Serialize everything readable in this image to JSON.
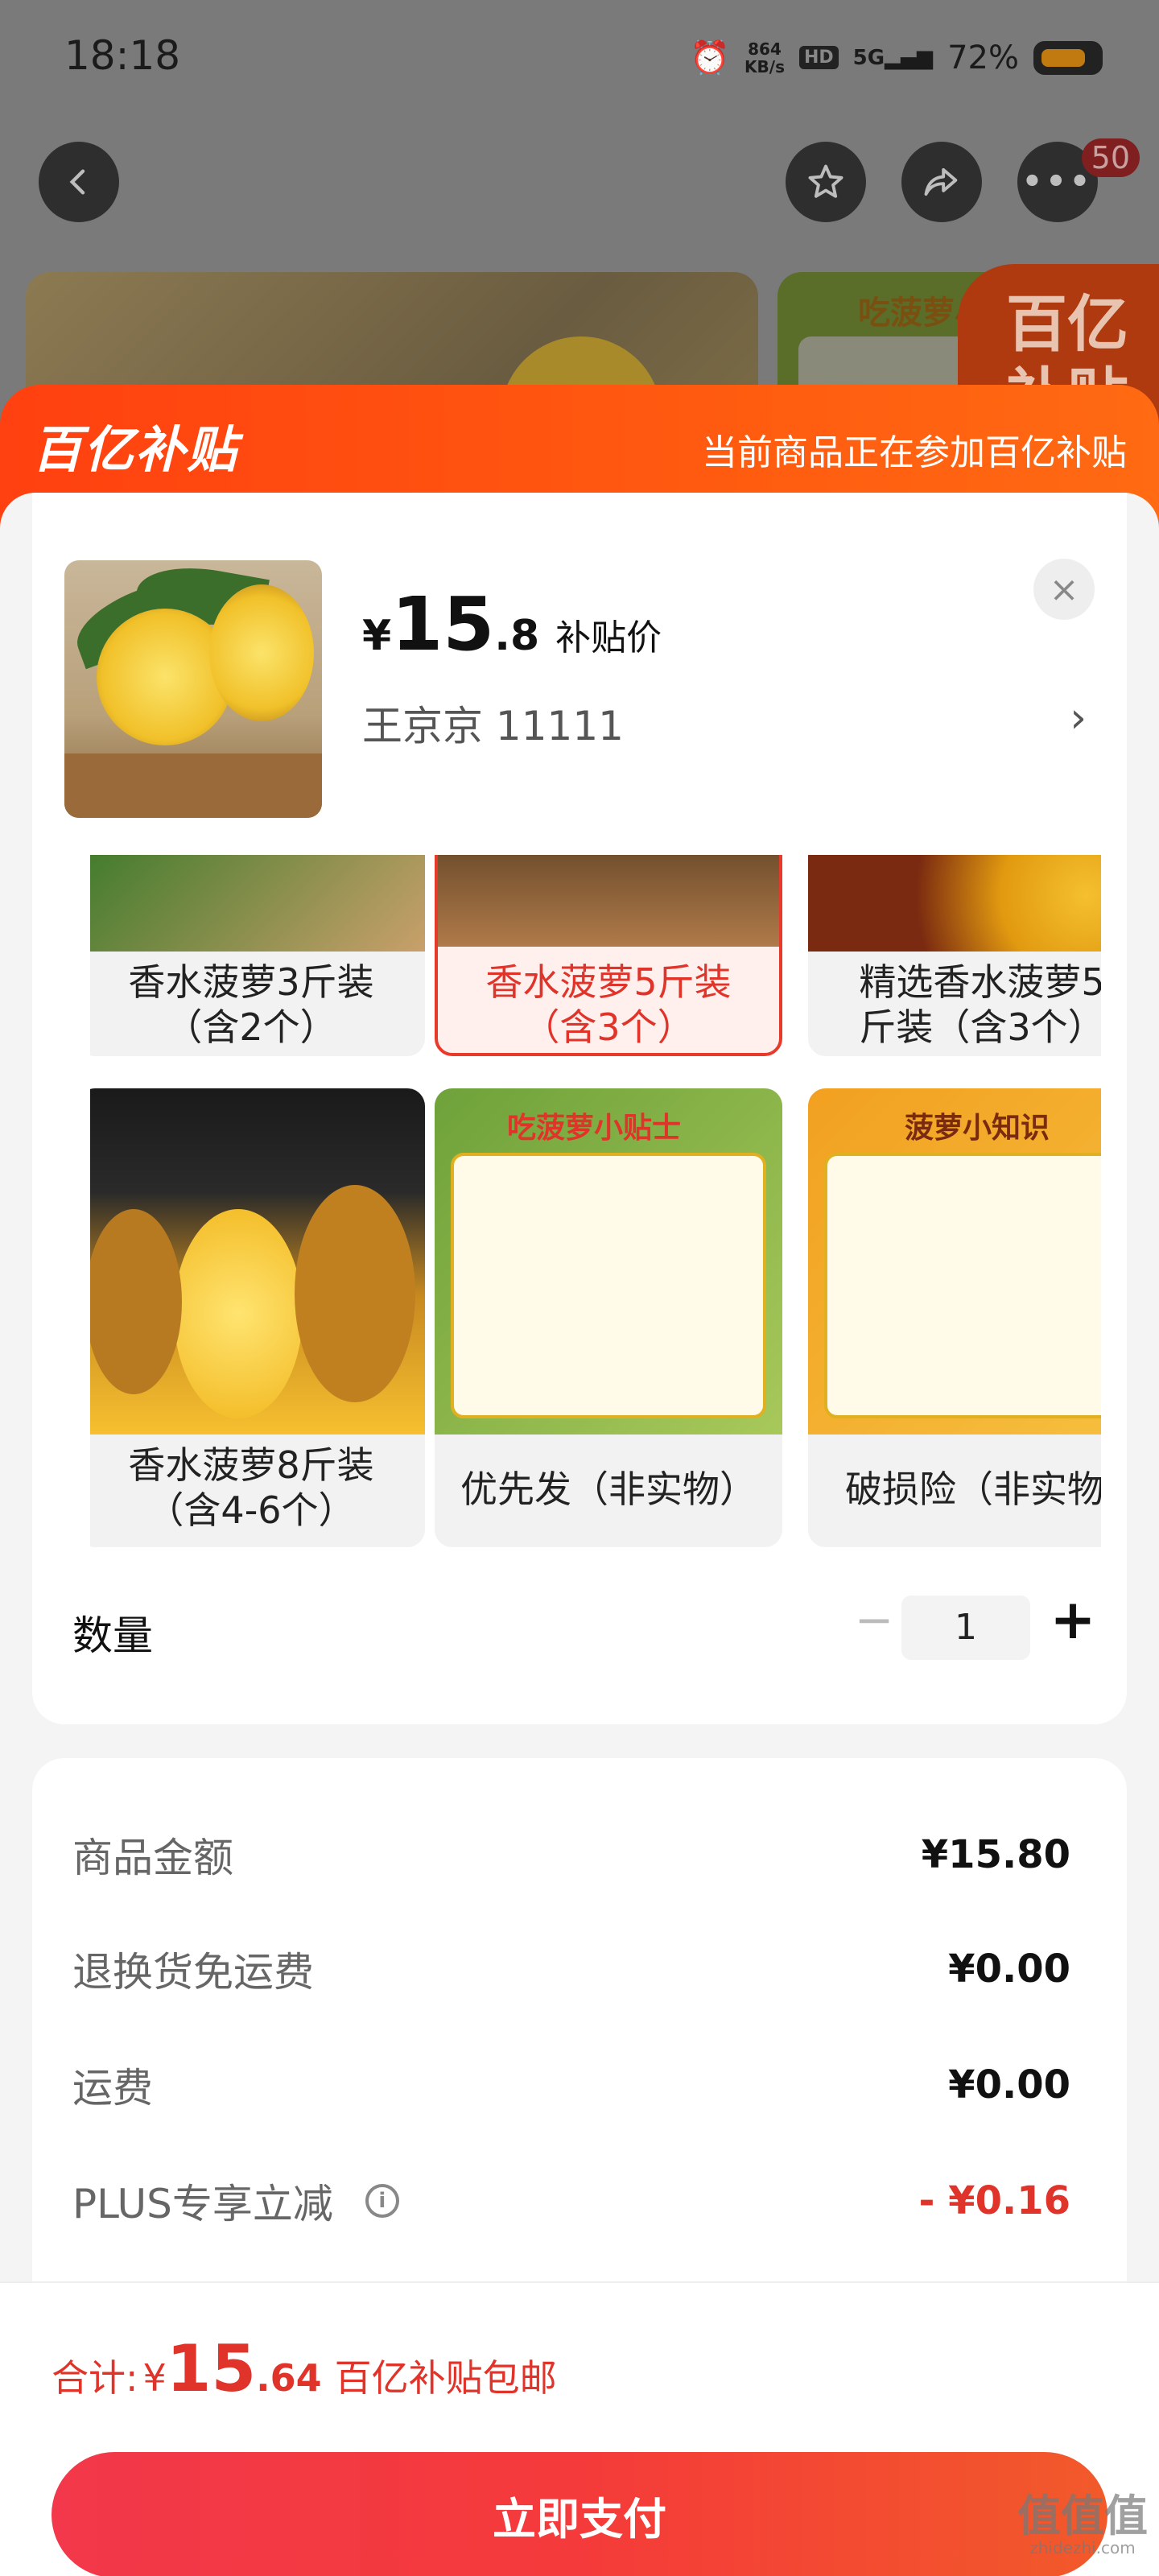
{
  "status": {
    "time": "18:18",
    "net_speed": "864",
    "net_unit": "KB/s",
    "hd": "HD",
    "signal": "5G",
    "battery": "72%"
  },
  "nav": {
    "back_icon": "chevron-left-icon",
    "badge": "50"
  },
  "background": {
    "image2_title": "吃菠萝小",
    "badge_text": "百亿 补贴"
  },
  "header": {
    "logo": "百亿补贴",
    "text": "当前商品正在参加百亿补贴"
  },
  "product": {
    "price_symbol": "¥",
    "price_int": "15",
    "price_dec": ".8",
    "price_tag": "补贴价",
    "seller": "王京京   11111",
    "close": "×",
    "chevron": "›"
  },
  "options": [
    {
      "label": "香水菠萝3斤装\n（含2个）",
      "selected": false
    },
    {
      "label": "香水菠萝5斤装\n（含3个）",
      "selected": true
    },
    {
      "label": "精选香水菠萝5\n斤装（含3个）",
      "selected": false
    },
    {
      "label": "香水菠萝8斤装\n（含4-6个）",
      "selected": false
    },
    {
      "label": "优先发（非实物）",
      "selected": false,
      "image_title": "吃菠萝小贴士"
    },
    {
      "label": "破损险（非实物",
      "selected": false,
      "image_title": "菠萝小知识"
    }
  ],
  "quantity": {
    "label": "数量",
    "minus": "−",
    "value": "1",
    "plus": "+"
  },
  "fees": [
    {
      "name": "商品金额",
      "value": "¥15.80"
    },
    {
      "name": "退换货免运费",
      "value": "¥0.00"
    },
    {
      "name": "运费",
      "value": "¥0.00"
    },
    {
      "name": "PLUS专享立减",
      "value": "- ¥0.16",
      "info_icon": "i"
    }
  ],
  "footer": {
    "total_label": "合计:",
    "total_sym": "¥",
    "total_int": "15",
    "total_dec": ".64",
    "total_note": "百亿补贴包邮",
    "pay_label": "立即支付"
  },
  "watermark": {
    "text": "值值值",
    "sub": "zhidezhi.com"
  },
  "colors": {
    "brand_red": "#e0342a",
    "brand_orange": "#ff5010"
  }
}
